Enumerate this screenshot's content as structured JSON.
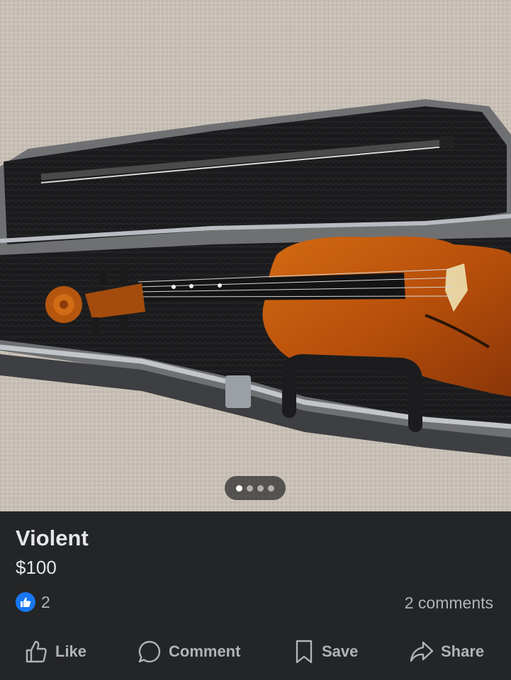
{
  "listing": {
    "title": "Violent",
    "price": "$100"
  },
  "gallery": {
    "image_subject": "violin-in-case",
    "pages": 4,
    "active_page": 1
  },
  "engagement": {
    "reaction_icon": "thumbs-up-icon",
    "reaction_count": "2",
    "comments_text": "2 comments"
  },
  "actions": {
    "like_label": "Like",
    "comment_label": "Comment",
    "save_label": "Save",
    "share_label": "Share"
  },
  "colors": {
    "background": "#242526",
    "text_primary": "#e4e6eb",
    "text_secondary": "#b0b3b8",
    "like_badge": "#1877f2"
  }
}
